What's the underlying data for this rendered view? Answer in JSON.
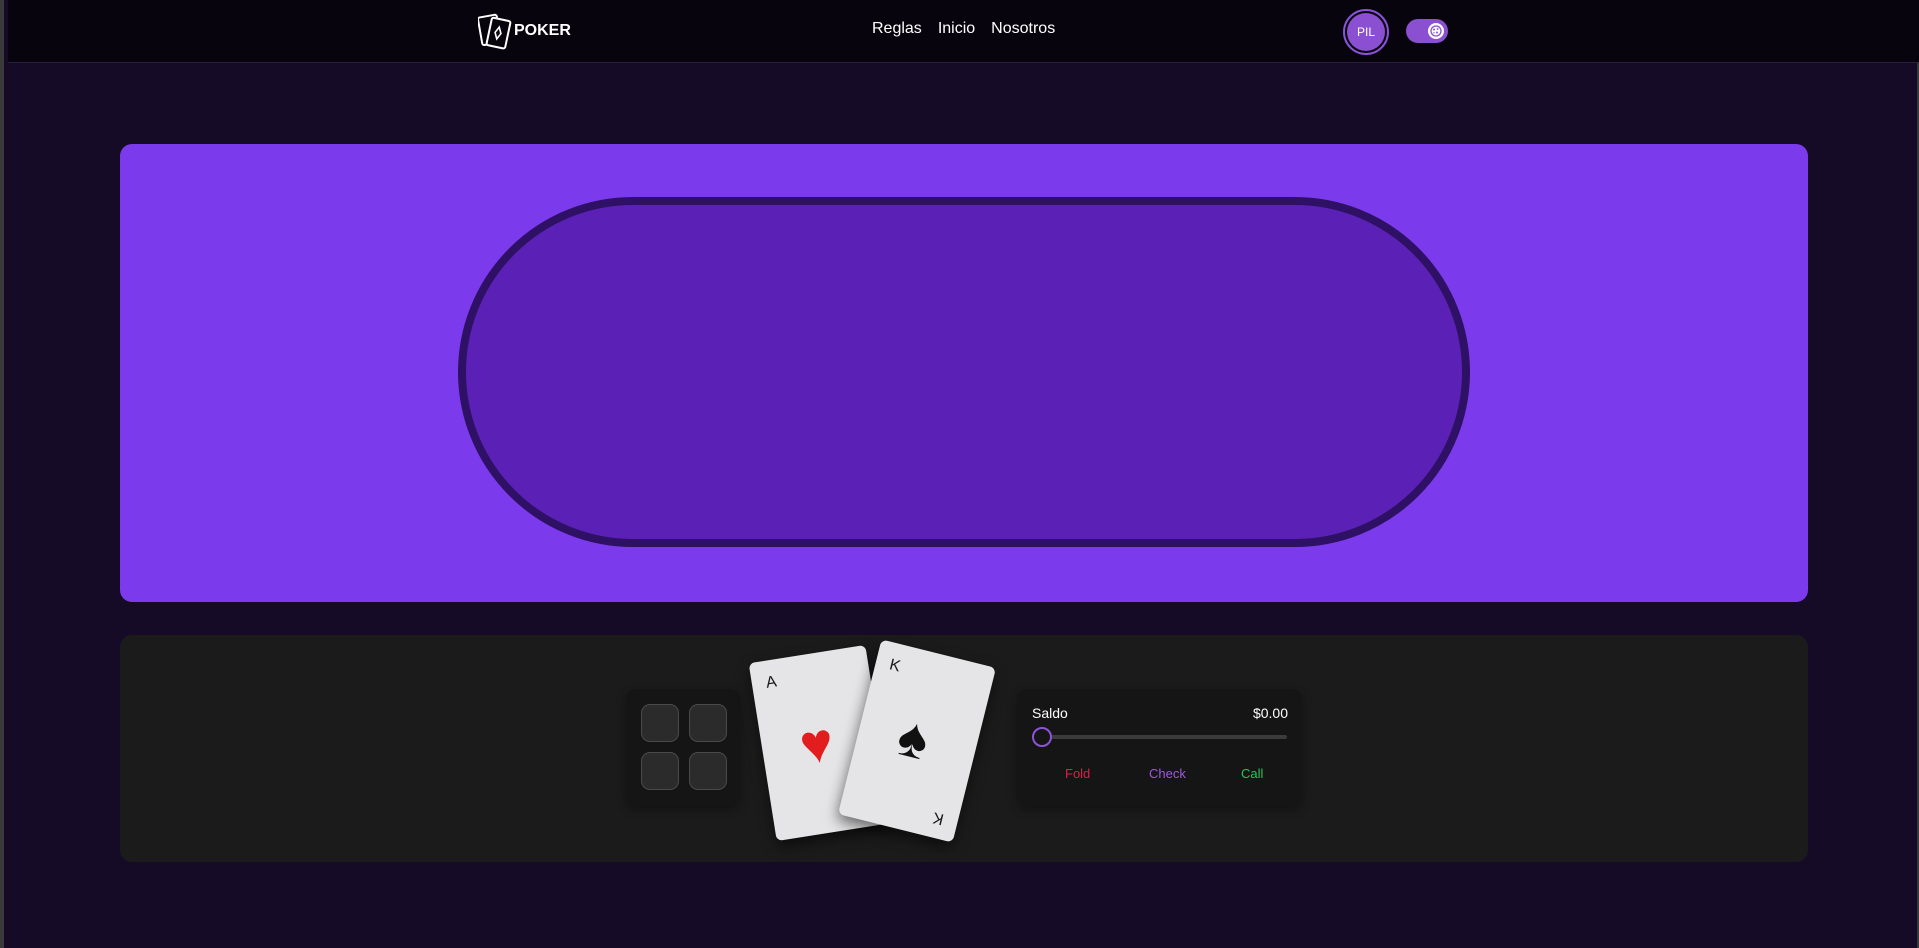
{
  "header": {
    "brand": "POKER",
    "nav": [
      "Reglas",
      "Inicio",
      "Nosotros"
    ],
    "avatar_initials": "PIL",
    "theme_toggle_icon": "theme-toggle-icon"
  },
  "table": {
    "colors": {
      "panel": "#7c3aed",
      "felt": "#5b21b6",
      "rail": "#2e1165"
    }
  },
  "player": {
    "cards": [
      {
        "rank": "A",
        "suit": "♥",
        "suit_color": "#e11d1d"
      },
      {
        "rank": "K",
        "suit": "♠",
        "suit_color": "#111111"
      }
    ],
    "balance_label": "Saldo",
    "balance_value": "$0.00",
    "bet_slider_value": 0,
    "actions": {
      "fold": {
        "label": "Fold",
        "color": "#e11d48"
      },
      "check": {
        "label": "Check",
        "color": "#9b59e0"
      },
      "call": {
        "label": "Call",
        "color": "#22c55e"
      }
    }
  }
}
